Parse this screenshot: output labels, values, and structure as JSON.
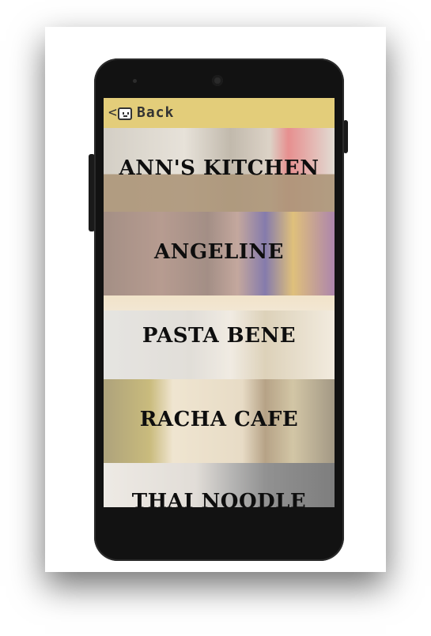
{
  "header": {
    "back_chevron": "<",
    "back_label": "Back"
  },
  "restaurants": [
    {
      "name": "ANN'S KITCHEN"
    },
    {
      "name": "ANGELINE"
    },
    {
      "name": "PASTA BENE"
    },
    {
      "name": "RACHA CAFE"
    },
    {
      "name": "THAI NOODLE"
    }
  ]
}
